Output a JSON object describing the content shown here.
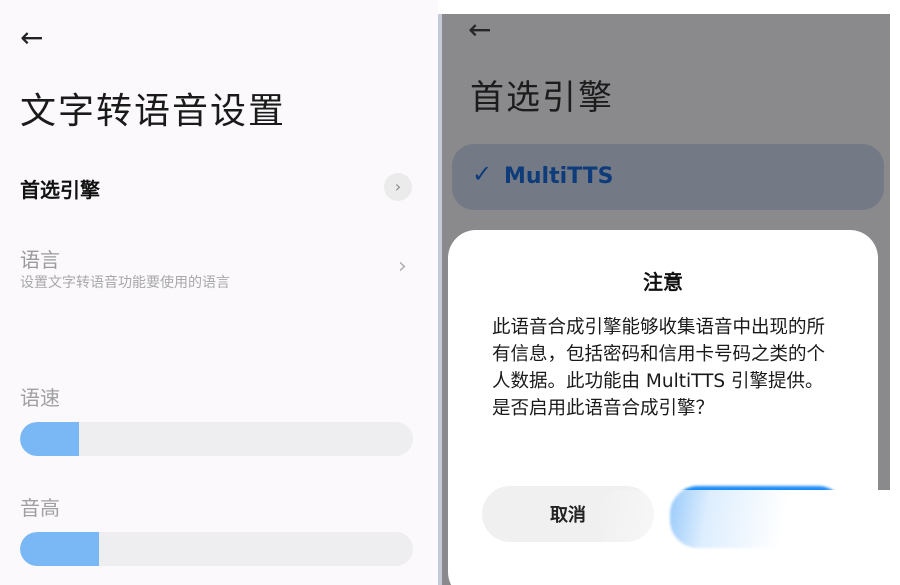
{
  "left": {
    "back_icon": "back-arrow-icon",
    "title": "文字转语音设置",
    "preferred_engine_label": "首选引擎",
    "language_label": "语言",
    "language_desc": "设置文字转语音功能要使用的语言",
    "speech_rate_label": "语速",
    "speech_rate_level": 0.15,
    "pitch_label": "音高",
    "pitch_level": 0.2
  },
  "right": {
    "back_icon": "back-arrow-icon",
    "title": "首选引擎",
    "selected_engine": "MultiTTS",
    "dialog": {
      "title": "注意",
      "body": "此语音合成引擎能够收集语音中出现的所有信息，包括密码和信用卡号码之类的个人数据。此功能由 MultiTTS 引擎提供。是否启用此语音合成引擎？",
      "cancel_label": "取消",
      "ok_label": ""
    }
  },
  "colors": {
    "accent": "#1e8cf6",
    "slider_fill": "#79b8f5",
    "dim_overlay": "#8a8a8d",
    "selected_text": "#0e3b79"
  }
}
